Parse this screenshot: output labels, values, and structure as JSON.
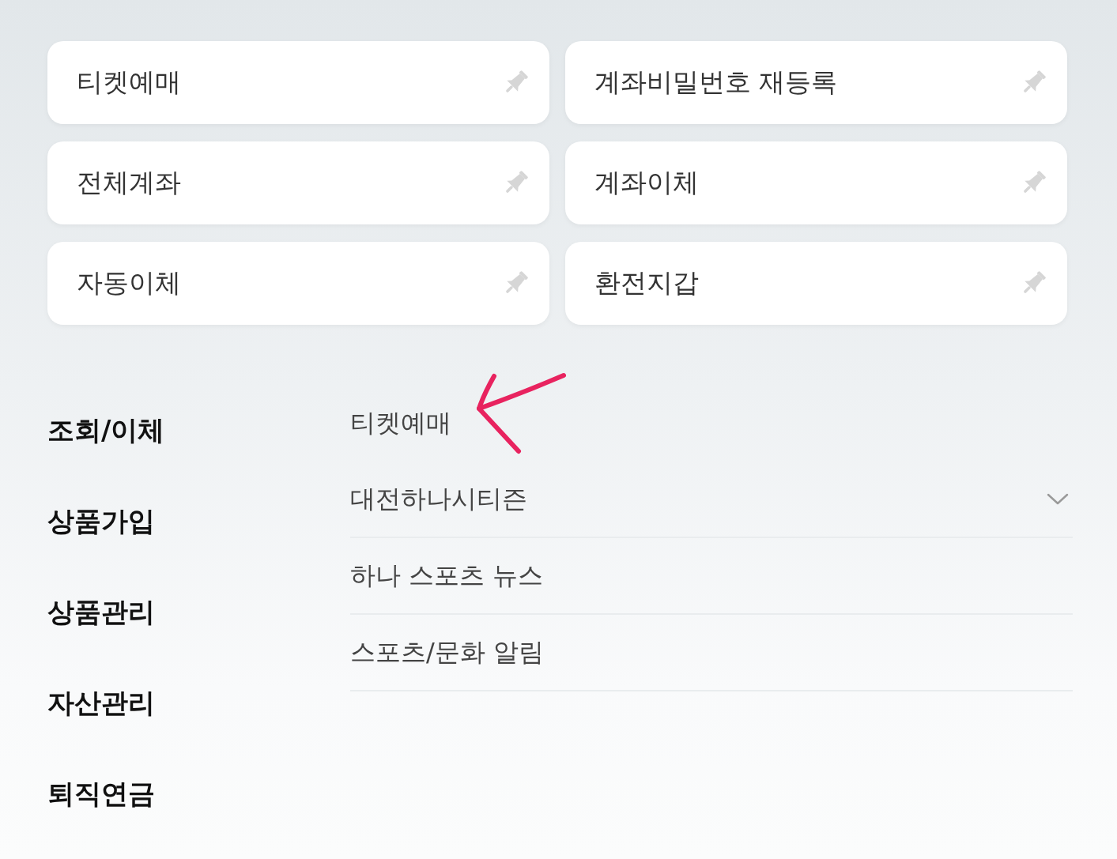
{
  "cards": [
    {
      "label": "티켓예매",
      "pinned": false
    },
    {
      "label": "계좌비밀번호 재등록",
      "pinned": false
    },
    {
      "label": "전체계좌",
      "pinned": false
    },
    {
      "label": "계좌이체",
      "pinned": false
    },
    {
      "label": "자동이체",
      "pinned": false
    },
    {
      "label": "환전지갑",
      "pinned": false
    }
  ],
  "categories": [
    "조회/이체",
    "상품가입",
    "상품관리",
    "자산관리",
    "퇴직연금"
  ],
  "submenu": {
    "title": "티켓예매",
    "items": [
      {
        "label": "대전하나시티즌",
        "kind": "expandable"
      },
      {
        "label": "하나 스포츠 뉴스",
        "kind": "link"
      },
      {
        "label": "스포츠/문화 알림",
        "kind": "link"
      }
    ]
  }
}
